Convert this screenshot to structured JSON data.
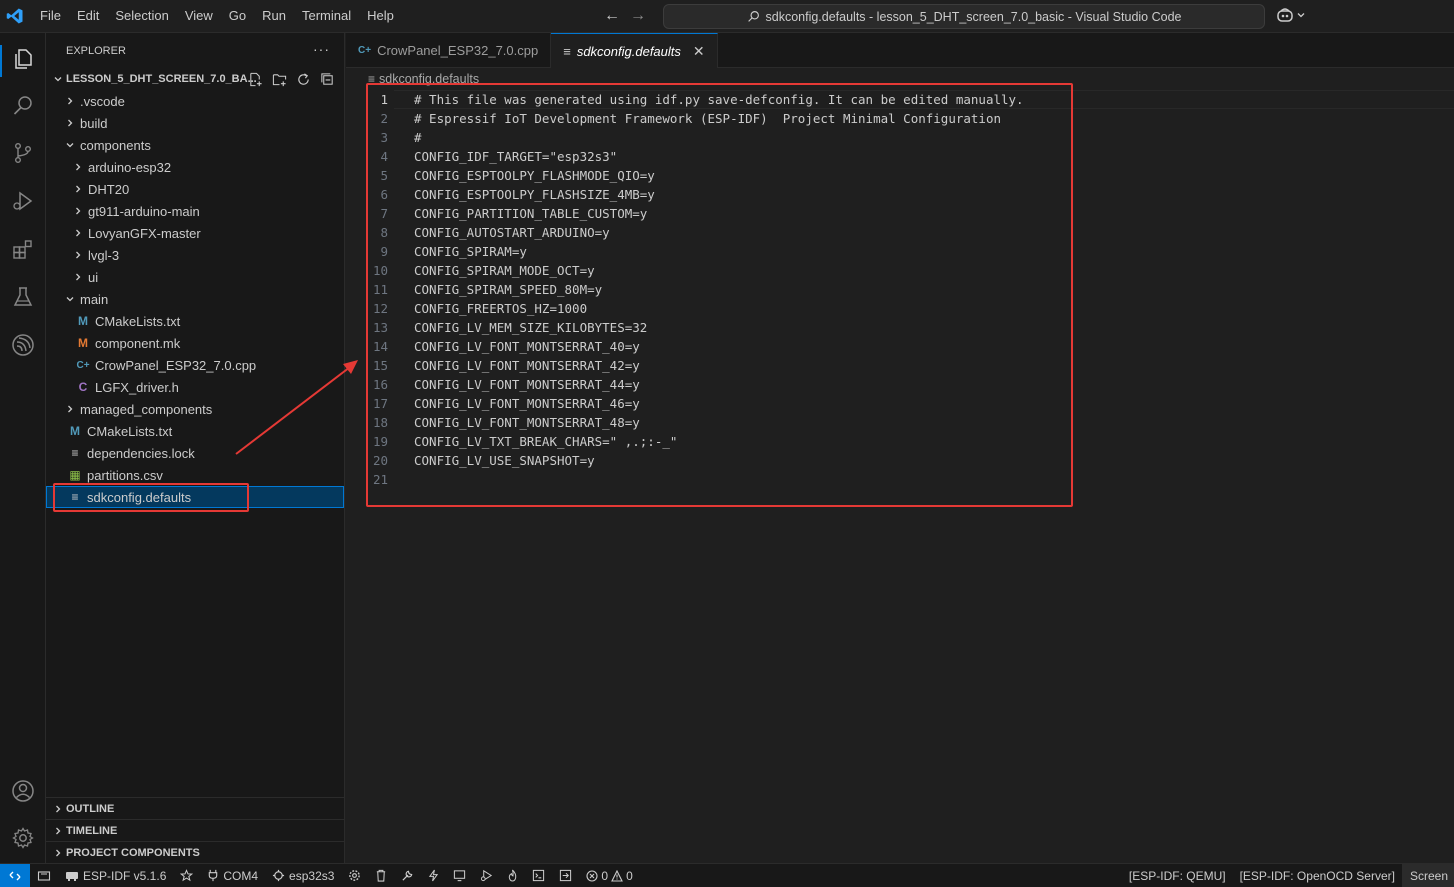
{
  "menu": [
    "File",
    "Edit",
    "Selection",
    "View",
    "Go",
    "Run",
    "Terminal",
    "Help"
  ],
  "search": {
    "text": "sdkconfig.defaults - lesson_5_DHT_screen_7.0_basic - Visual Studio Code"
  },
  "sidebar": {
    "title": "EXPLORER",
    "folder": "LESSON_5_DHT_SCREEN_7.0_BA...",
    "tree": [
      {
        "label": ".vscode",
        "type": "folder",
        "depth": 1
      },
      {
        "label": "build",
        "type": "folder",
        "depth": 1
      },
      {
        "label": "components",
        "type": "folder-open",
        "depth": 1
      },
      {
        "label": "arduino-esp32",
        "type": "folder",
        "depth": 2
      },
      {
        "label": "DHT20",
        "type": "folder",
        "depth": 2
      },
      {
        "label": "gt911-arduino-main",
        "type": "folder",
        "depth": 2
      },
      {
        "label": "LovyanGFX-master",
        "type": "folder",
        "depth": 2
      },
      {
        "label": "lvgl-3",
        "type": "folder",
        "depth": 2
      },
      {
        "label": "ui",
        "type": "folder",
        "depth": 2
      },
      {
        "label": "main",
        "type": "folder-open",
        "depth": 1
      },
      {
        "label": "CMakeLists.txt",
        "type": "cmake",
        "depth": 2
      },
      {
        "label": "component.mk",
        "type": "make",
        "depth": 2
      },
      {
        "label": "CrowPanel_ESP32_7.0.cpp",
        "type": "cpp",
        "depth": 2
      },
      {
        "label": "LGFX_driver.h",
        "type": "header",
        "depth": 2
      },
      {
        "label": "managed_components",
        "type": "folder",
        "depth": 1
      },
      {
        "label": "CMakeLists.txt",
        "type": "cmake",
        "depth": 1
      },
      {
        "label": "dependencies.lock",
        "type": "text",
        "depth": 1
      },
      {
        "label": "partitions.csv",
        "type": "csv",
        "depth": 1
      },
      {
        "label": "sdkconfig.defaults",
        "type": "text",
        "depth": 1,
        "selected": true
      }
    ],
    "sections": [
      "OUTLINE",
      "TIMELINE",
      "PROJECT COMPONENTS"
    ]
  },
  "tabs": [
    {
      "label": "CrowPanel_ESP32_7.0.cpp",
      "active": false
    },
    {
      "label": "sdkconfig.defaults",
      "active": true
    }
  ],
  "breadcrumb": "sdkconfig.defaults",
  "code": [
    "# This file was generated using idf.py save-defconfig. It can be edited manually.",
    "# Espressif IoT Development Framework (ESP-IDF)  Project Minimal Configuration",
    "#",
    "CONFIG_IDF_TARGET=\"esp32s3\"",
    "CONFIG_ESPTOOLPY_FLASHMODE_QIO=y",
    "CONFIG_ESPTOOLPY_FLASHSIZE_4MB=y",
    "CONFIG_PARTITION_TABLE_CUSTOM=y",
    "CONFIG_AUTOSTART_ARDUINO=y",
    "CONFIG_SPIRAM=y",
    "CONFIG_SPIRAM_MODE_OCT=y",
    "CONFIG_SPIRAM_SPEED_80M=y",
    "CONFIG_FREERTOS_HZ=1000",
    "CONFIG_LV_MEM_SIZE_KILOBYTES=32",
    "CONFIG_LV_FONT_MONTSERRAT_40=y",
    "CONFIG_LV_FONT_MONTSERRAT_42=y",
    "CONFIG_LV_FONT_MONTSERRAT_44=y",
    "CONFIG_LV_FONT_MONTSERRAT_46=y",
    "CONFIG_LV_FONT_MONTSERRAT_48=y",
    "CONFIG_LV_TXT_BREAK_CHARS=\" ,.;:-_\"",
    "CONFIG_LV_USE_SNAPSHOT=y",
    ""
  ],
  "status": {
    "idf_version": "ESP-IDF v5.1.6",
    "port": "COM4",
    "target": "esp32s3",
    "errors": "0",
    "warnings": "0",
    "qemu": "[ESP-IDF: QEMU]",
    "openocd": "[ESP-IDF: OpenOCD Server]",
    "screen": "Screen"
  },
  "colors": {
    "accent": "#0078d4",
    "highlight": "#e53935"
  }
}
